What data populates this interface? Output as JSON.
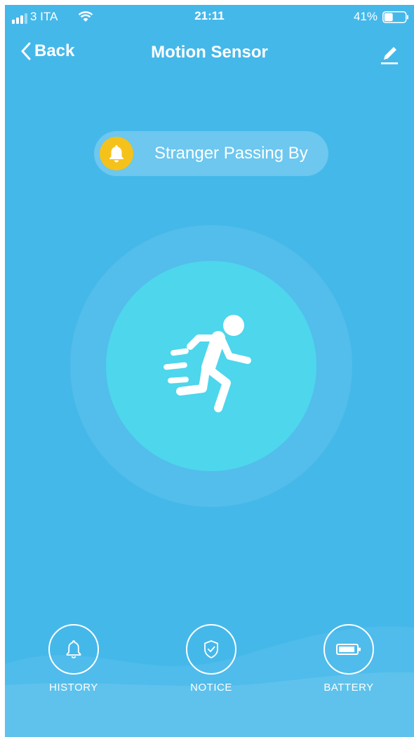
{
  "status_bar": {
    "carrier": "3 ITA",
    "time": "21:11",
    "battery_percent": "41%",
    "battery_level": 0.41,
    "signal_bars": 3
  },
  "nav": {
    "back_label": "Back",
    "title": "Motion Sensor",
    "edit_icon": "pencil-icon"
  },
  "status_pill": {
    "icon": "bell-icon",
    "text": "Stranger Passing By",
    "icon_color": "#f4c21b"
  },
  "center": {
    "icon": "running-person-icon",
    "color": "#4dd6ec"
  },
  "actions": [
    {
      "label": "HISTORY",
      "icon": "bell-outline-icon"
    },
    {
      "label": "NOTICE",
      "icon": "shield-check-icon"
    },
    {
      "label": "BATTERY",
      "icon": "battery-icon"
    }
  ],
  "colors": {
    "background": "#45b8ea"
  }
}
